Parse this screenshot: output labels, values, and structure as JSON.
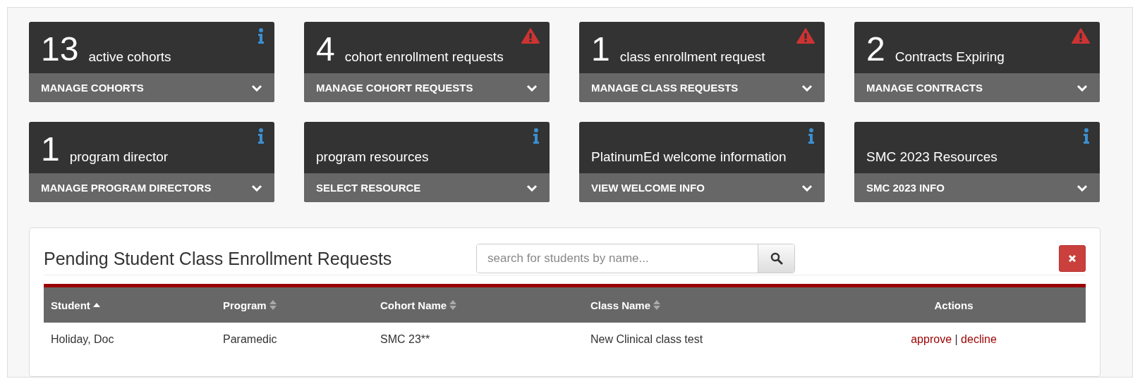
{
  "tiles": [
    {
      "count": "13",
      "label": "active cohorts",
      "warning": false,
      "action": "MANAGE COHORTS"
    },
    {
      "count": "4",
      "label": "cohort enrollment requests",
      "warning": true,
      "action": "MANAGE COHORT REQUESTS"
    },
    {
      "count": "1",
      "label": "class enrollment request",
      "warning": true,
      "action": "MANAGE CLASS REQUESTS"
    },
    {
      "count": "2",
      "label": "Contracts Expiring",
      "warning": true,
      "action": "MANAGE CONTRACTS"
    },
    {
      "count": "1",
      "label": "program director",
      "warning": false,
      "action": "MANAGE PROGRAM DIRECTORS"
    },
    {
      "label": "program resources",
      "warning": false,
      "action": "SELECT RESOURCE"
    },
    {
      "label": "PlatinumEd welcome information",
      "warning": false,
      "action": "VIEW WELCOME INFO"
    },
    {
      "label": "SMC 2023 Resources",
      "warning": false,
      "action": "SMC 2023 INFO"
    }
  ],
  "panel": {
    "title": "Pending Student Class Enrollment Requests",
    "search": {
      "placeholder": "search for students by name..."
    },
    "table": {
      "columns": [
        {
          "label": "Student",
          "sortable": true,
          "sorted": true
        },
        {
          "label": "Program",
          "sortable": true,
          "sorted": false
        },
        {
          "label": "Cohort Name",
          "sortable": true,
          "sorted": false
        },
        {
          "label": "Class Name",
          "sortable": true,
          "sorted": false
        },
        {
          "label": "Actions",
          "sortable": false
        }
      ],
      "rows": [
        {
          "cells": [
            "Holiday, Doc",
            "Paramedic",
            "SMC 23**",
            "New Clinical class test"
          ],
          "actions": [
            "approve",
            "decline"
          ],
          "separator": "|"
        }
      ]
    }
  }
}
